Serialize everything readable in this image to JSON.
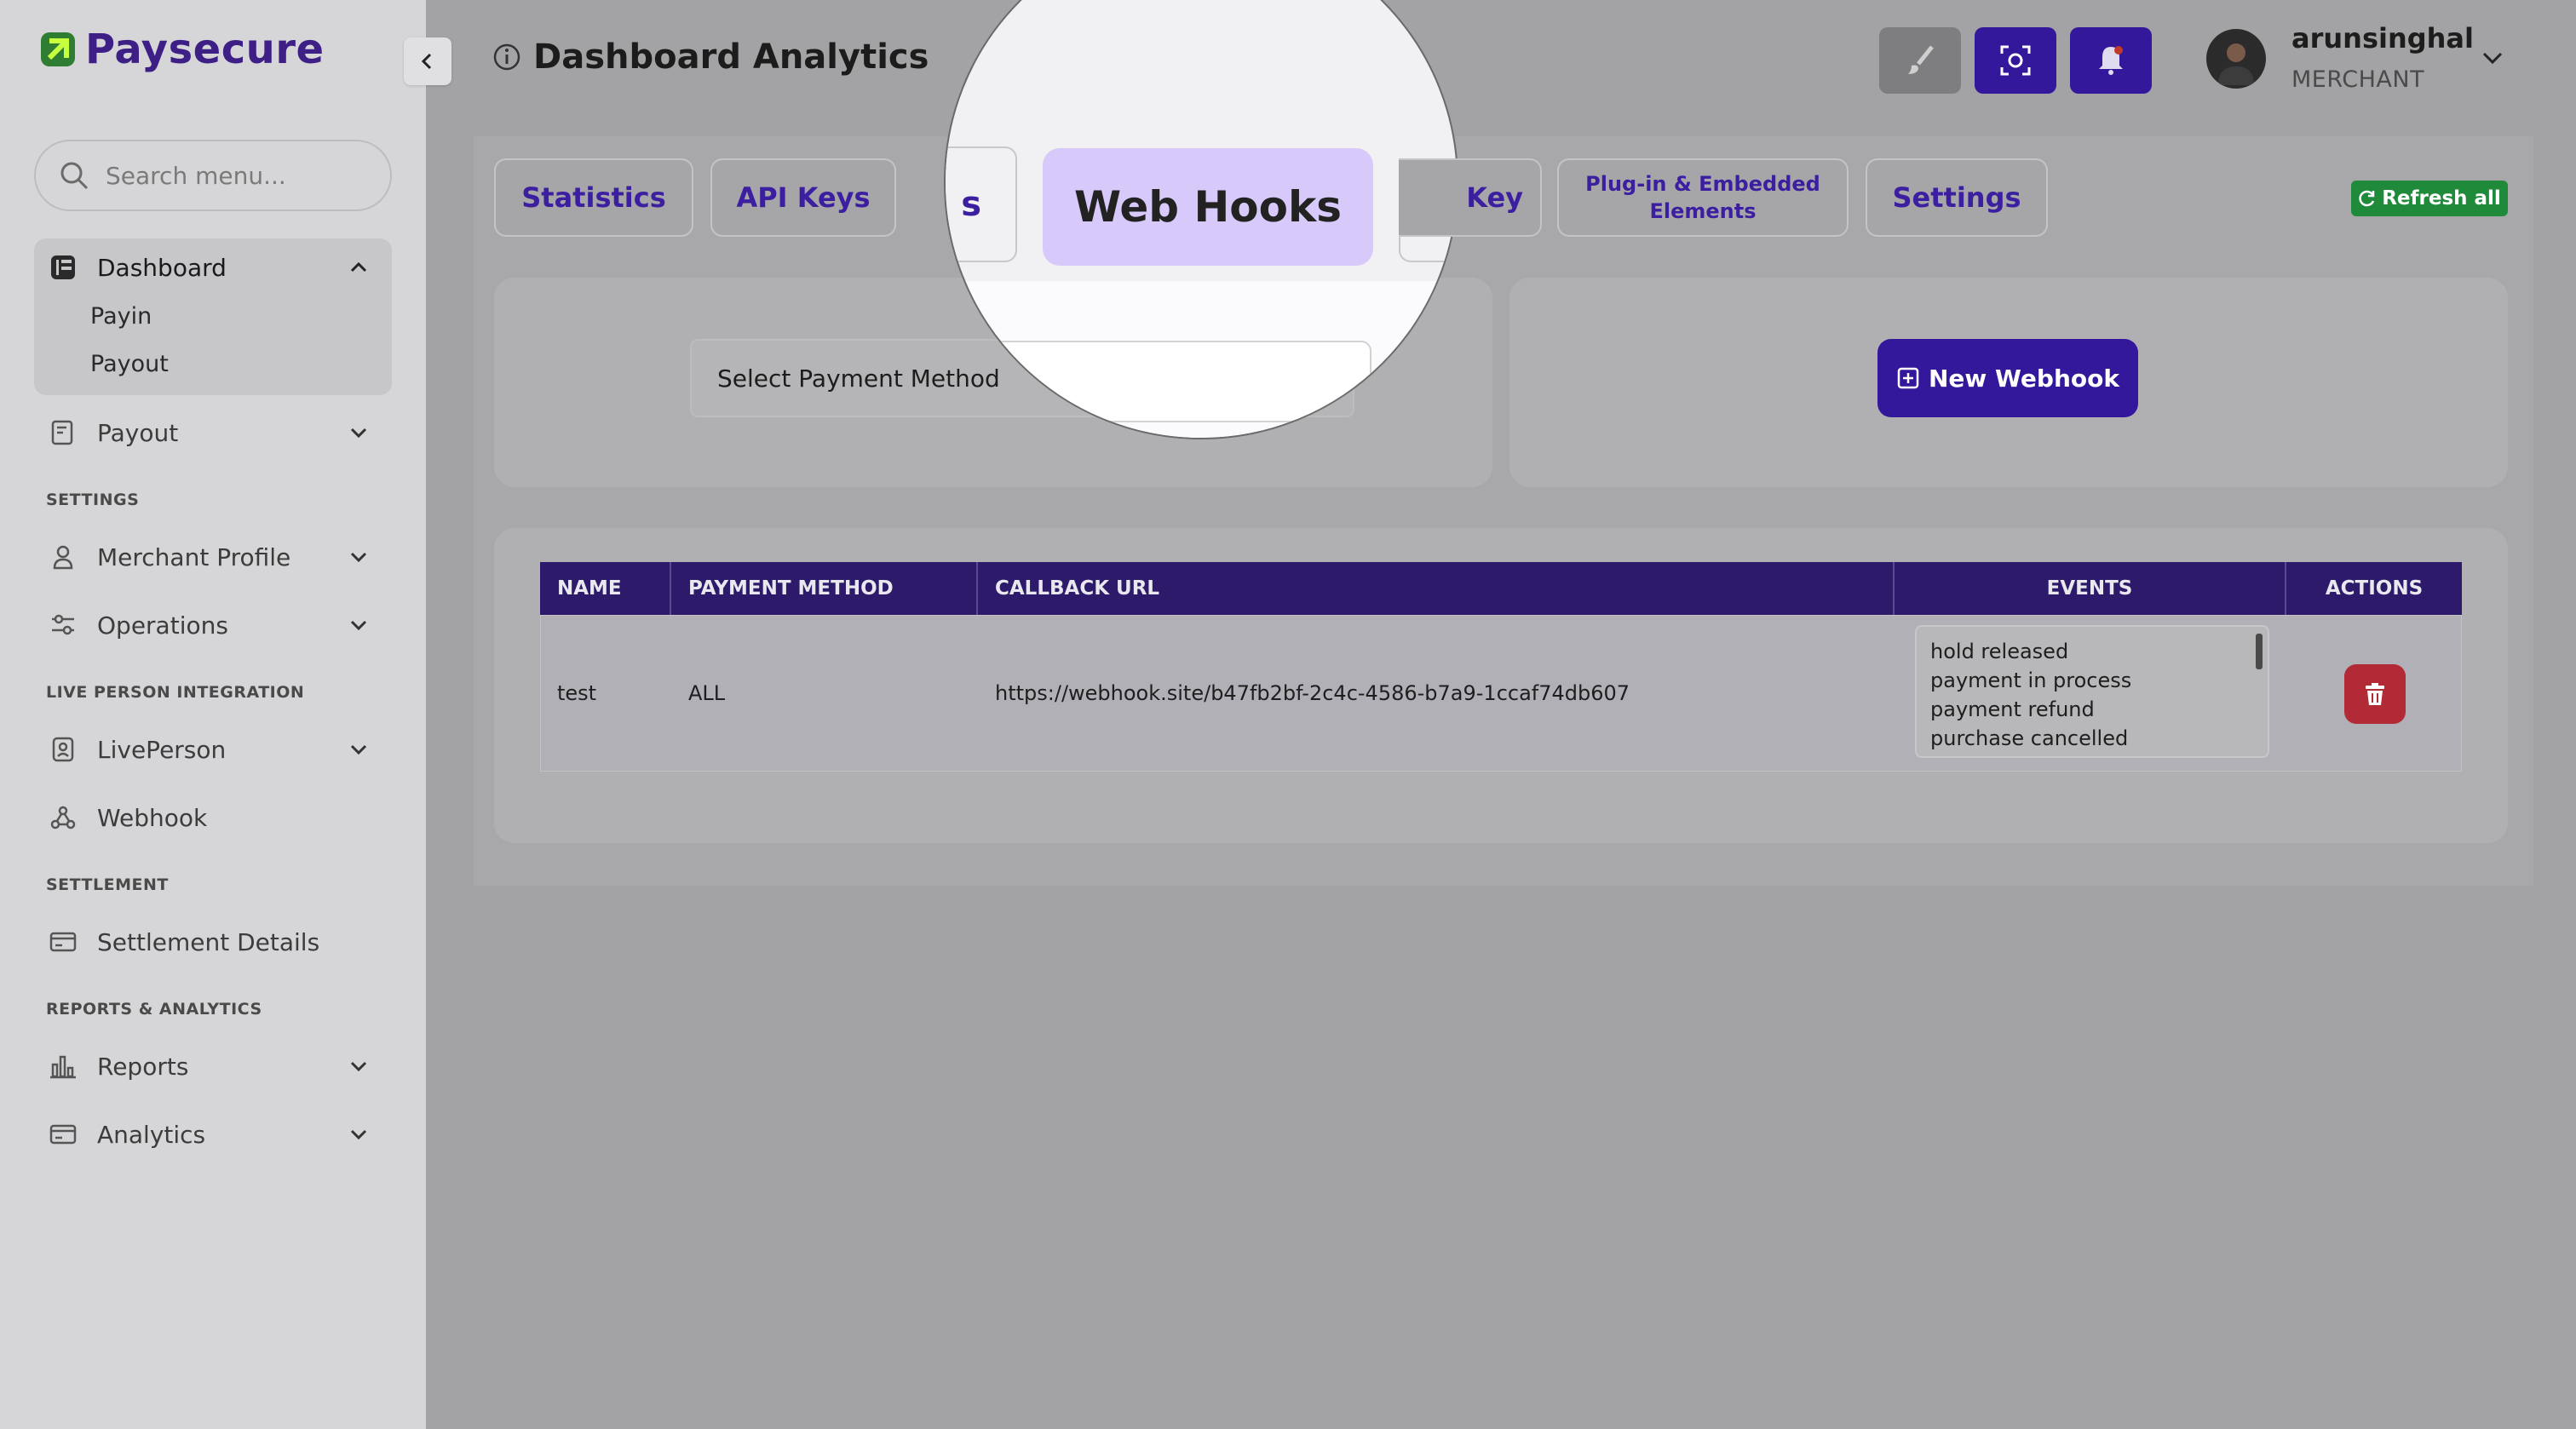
{
  "brand": {
    "name": "Paysecure",
    "accent": "#3d1f86"
  },
  "sidebar": {
    "search_placeholder": "Search menu...",
    "dashboard": {
      "label": "Dashboard",
      "sub": [
        "Payin",
        "Payout"
      ]
    },
    "payout": {
      "label": "Payout"
    },
    "settings_section": "SETTINGS",
    "merchant_profile": {
      "label": "Merchant Profile"
    },
    "operations": {
      "label": "Operations"
    },
    "live_section": "LIVE PERSON INTEGRATION",
    "liveperson": {
      "label": "LivePerson"
    },
    "webhook": {
      "label": "Webhook"
    },
    "settlement_section": "SETTLEMENT",
    "settlement_details": {
      "label": "Settlement Details"
    },
    "reports_section": "REPORTS & ANALYTICS",
    "reports": {
      "label": "Reports"
    },
    "analytics": {
      "label": "Analytics"
    }
  },
  "header": {
    "title": "Dashboard Analytics",
    "user_name": "arunsinghal",
    "user_role": "MERCHANT"
  },
  "tabs": {
    "statistics": "Statistics",
    "api_keys": "API Keys",
    "fragment_left": "s",
    "web_hooks": "Web Hooks",
    "fragment_right": "Key",
    "plugin_line1": "Plug-in & Embedded",
    "plugin_line2": "Elements",
    "settings": "Settings",
    "refresh_all": "Refresh all"
  },
  "filters": {
    "select_payment_method": "Select Payment Method",
    "new_webhook": "New Webhook"
  },
  "table": {
    "headers": [
      "NAME",
      "PAYMENT METHOD",
      "CALLBACK URL",
      "EVENTS",
      "ACTIONS"
    ],
    "rows": [
      {
        "name": "test",
        "payment_method": "ALL",
        "callback_url": "https://webhook.site/b47fb2bf-2c4c-4586-b7a9-1ccaf74db607",
        "events": [
          "hold released",
          "payment in process",
          "payment refund",
          "purchase cancelled"
        ]
      }
    ]
  },
  "colors": {
    "table_header": "#2d1a6a",
    "primary_button": "#34189c",
    "refresh_button": "#1f8a3a",
    "delete_button": "#b12a36",
    "active_tab": "#d7c9fa"
  },
  "icons": [
    "logo-icon",
    "search-icon",
    "dashboard-icon",
    "chevron-up-icon",
    "chevron-down-icon",
    "payout-icon",
    "user-icon",
    "sliders-icon",
    "shield-icon",
    "webhook-icon",
    "card-icon",
    "bar-chart-icon",
    "chevron-left-icon",
    "info-icon",
    "brush-icon",
    "scan-icon",
    "bell-icon",
    "refresh-icon",
    "plus-square-icon",
    "trash-icon"
  ]
}
